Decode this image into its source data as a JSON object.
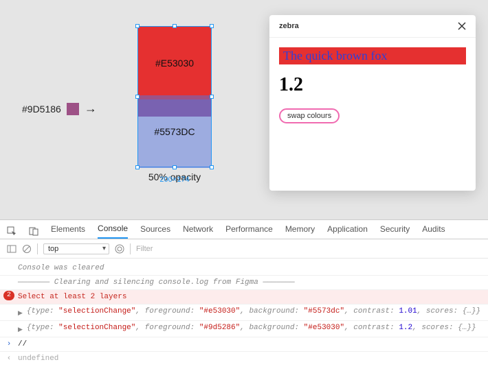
{
  "canvas": {
    "swatch_hex": "#9D5186",
    "rect_red_hex": "#E53030",
    "rect_blue_hex": "#5573DC",
    "sel_dims": "200×174",
    "caption": "50% opacity"
  },
  "plugin": {
    "title": "zebra",
    "sample_text": "The quick brown fox",
    "ratio": "1.2",
    "swap_label": "swap colours"
  },
  "devtools": {
    "tabs": [
      "Elements",
      "Console",
      "Sources",
      "Network",
      "Performance",
      "Memory",
      "Application",
      "Security",
      "Audits"
    ],
    "active_tab": "Console",
    "scope": "top",
    "filter_placeholder": "Filter",
    "lines": {
      "cleared": "Console was cleared",
      "silence": "——————— Clearing and silencing console.log from Figma ———————",
      "error": "Select at least 2 layers",
      "error_count": "2",
      "obj1": {
        "type": "selectionChange",
        "foreground": "#e53030",
        "background": "#5573dc",
        "contrast": "1.01"
      },
      "obj2": {
        "type": "selectionChange",
        "foreground": "#9d5286",
        "background": "#e53030",
        "contrast": "1.2"
      },
      "prompt": "//",
      "undef": "undefined"
    }
  }
}
